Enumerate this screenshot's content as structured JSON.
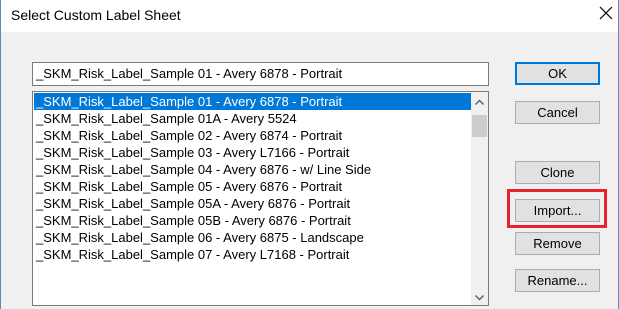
{
  "dialog": {
    "title": "Select Custom Label Sheet",
    "close_icon": "close-icon"
  },
  "name_field": {
    "value": "_SKM_Risk_Label_Sample 01 - Avery 6878 - Portrait"
  },
  "list": {
    "selected_index": 0,
    "items": [
      "_SKM_Risk_Label_Sample 01 - Avery 6878 - Portrait",
      "_SKM_Risk_Label_Sample 01A - Avery 5524",
      "_SKM_Risk_Label_Sample 02 - Avery 6874 - Portrait",
      "_SKM_Risk_Label_Sample 03 - Avery L7166 - Portrait",
      "_SKM_Risk_Label_Sample 04 - Avery 6876 - w/ Line Side",
      "_SKM_Risk_Label_Sample 05 - Avery 6876 - Portrait",
      "_SKM_Risk_Label_Sample 05A - Avery 6876 - Portrait",
      "_SKM_Risk_Label_Sample 05B - Avery 6876 - Portrait",
      "_SKM_Risk_Label_Sample 06 - Avery 6875 - Landscape",
      "_SKM_Risk_Label_Sample 07 - Avery L7168 - Portrait"
    ]
  },
  "buttons": {
    "ok": "OK",
    "cancel": "Cancel",
    "clone": "Clone",
    "import": "Import...",
    "remove": "Remove",
    "rename": "Rename..."
  },
  "colors": {
    "selection": "#0078d7",
    "annotation_highlight": "#e8232b",
    "dialog_background": "#f0f0f0"
  }
}
